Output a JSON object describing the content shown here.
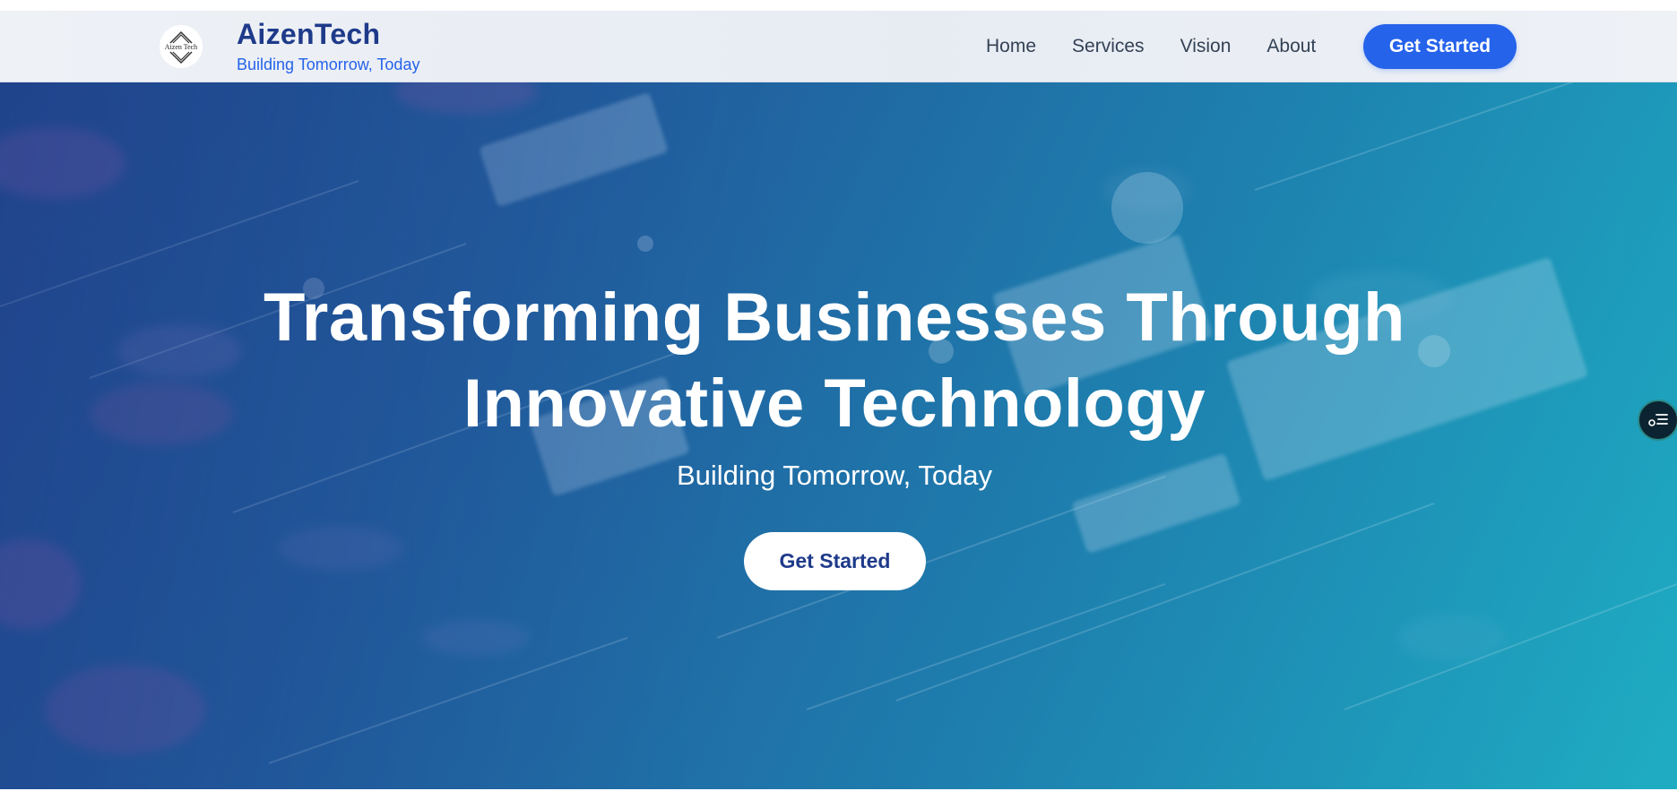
{
  "header": {
    "logo_text": "Aizen Tech",
    "brand_name": "AizenTech",
    "tagline": "Building Tomorrow, Today",
    "logo_icon": "chevron-diamond-logo"
  },
  "nav": {
    "items": [
      {
        "label": "Home"
      },
      {
        "label": "Services"
      },
      {
        "label": "Vision"
      },
      {
        "label": "About"
      }
    ],
    "cta_label": "Get Started"
  },
  "hero": {
    "title_line1": "Transforming Businesses Through",
    "title_line2": "Innovative Technology",
    "subtitle": "Building Tomorrow, Today",
    "cta_label": "Get Started",
    "background_image": "circuit-board-photo"
  },
  "side_widget": {
    "icon": "accessibility-settings-icon"
  },
  "colors": {
    "brand": "#1e3a8a",
    "accent": "#2563eb",
    "hero_start": "#24508f",
    "hero_end": "#23aec3"
  }
}
